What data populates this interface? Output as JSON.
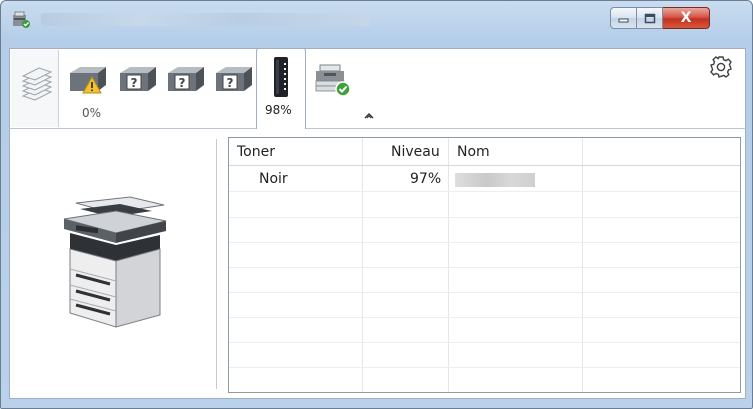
{
  "window": {
    "controls": {
      "minimize_icon": "minimize-icon",
      "maximize_icon": "maximize-icon",
      "close_label": "X"
    }
  },
  "toolbar": {
    "trays": [
      {
        "icon": "warning-tray-icon",
        "level": "0%"
      },
      {
        "icon": "unknown-tray-icon"
      },
      {
        "icon": "unknown-tray-icon"
      },
      {
        "icon": "unknown-tray-icon"
      }
    ],
    "toner_tab": {
      "icon": "toner-cartridge-icon",
      "level": "98%"
    },
    "device_icon": "device-ok-icon",
    "collapse_icon": "chevron-up-icon",
    "settings_icon": "gear-icon"
  },
  "grid": {
    "columns": [
      "Toner",
      "Niveau",
      "Nom"
    ],
    "rows": [
      {
        "toner": "Noir",
        "level": "97%"
      }
    ]
  },
  "colors": {
    "titlebar": "#b9d1ea",
    "close": "#c3301f",
    "border": "#a0aec0"
  }
}
